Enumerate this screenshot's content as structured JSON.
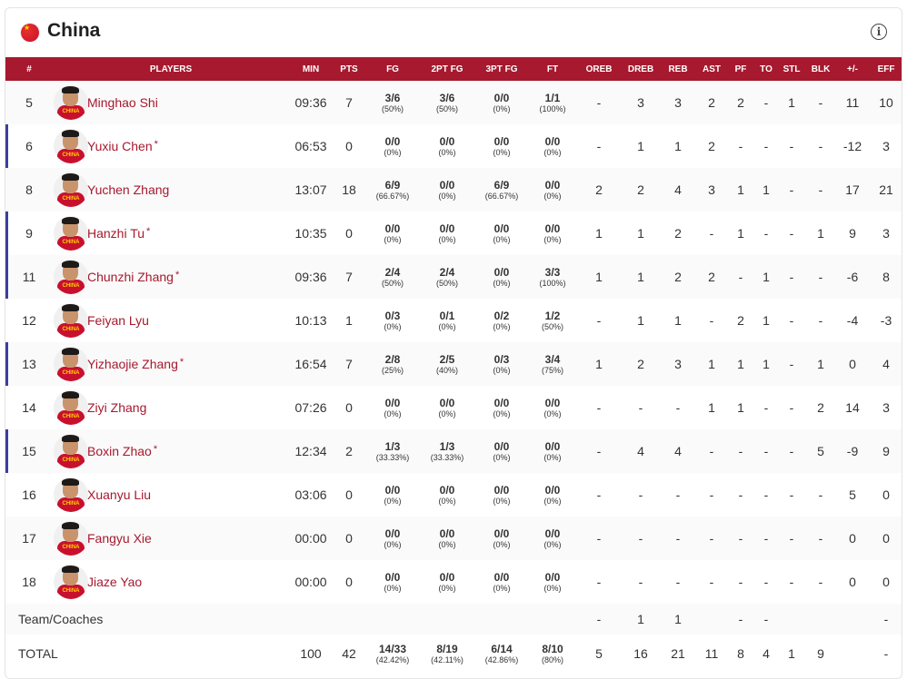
{
  "header": {
    "team_name": "China",
    "flag_icon": "china-flag-icon",
    "info_icon": "info-icon"
  },
  "colors": {
    "header_bar": "#a6192e",
    "player_name": "#a6192e",
    "starter_marker": "#3b3fa0"
  },
  "columns": [
    "#",
    "PLAYERS",
    "MIN",
    "PTS",
    "FG",
    "2PT FG",
    "3PT FG",
    "FT",
    "OREB",
    "DREB",
    "REB",
    "AST",
    "PF",
    "TO",
    "STL",
    "BLK",
    "+/-",
    "EFF"
  ],
  "players": [
    {
      "num": "5",
      "name": "Minghao Shi",
      "starter": false,
      "min": "09:36",
      "pts": "7",
      "fg": "3/6",
      "fg_pct": "(50%)",
      "p2": "3/6",
      "p2_pct": "(50%)",
      "p3": "0/0",
      "p3_pct": "(0%)",
      "ft": "1/1",
      "ft_pct": "(100%)",
      "oreb": "-",
      "dreb": "3",
      "reb": "3",
      "ast": "2",
      "pf": "2",
      "to": "-",
      "stl": "1",
      "blk": "-",
      "pm": "11",
      "eff": "10"
    },
    {
      "num": "6",
      "name": "Yuxiu Chen",
      "starter": true,
      "min": "06:53",
      "pts": "0",
      "fg": "0/0",
      "fg_pct": "(0%)",
      "p2": "0/0",
      "p2_pct": "(0%)",
      "p3": "0/0",
      "p3_pct": "(0%)",
      "ft": "0/0",
      "ft_pct": "(0%)",
      "oreb": "-",
      "dreb": "1",
      "reb": "1",
      "ast": "2",
      "pf": "-",
      "to": "-",
      "stl": "-",
      "blk": "-",
      "pm": "-12",
      "eff": "3"
    },
    {
      "num": "8",
      "name": "Yuchen Zhang",
      "starter": false,
      "min": "13:07",
      "pts": "18",
      "fg": "6/9",
      "fg_pct": "(66.67%)",
      "p2": "0/0",
      "p2_pct": "(0%)",
      "p3": "6/9",
      "p3_pct": "(66.67%)",
      "ft": "0/0",
      "ft_pct": "(0%)",
      "oreb": "2",
      "dreb": "2",
      "reb": "4",
      "ast": "3",
      "pf": "1",
      "to": "1",
      "stl": "-",
      "blk": "-",
      "pm": "17",
      "eff": "21"
    },
    {
      "num": "9",
      "name": "Hanzhi Tu",
      "starter": true,
      "min": "10:35",
      "pts": "0",
      "fg": "0/0",
      "fg_pct": "(0%)",
      "p2": "0/0",
      "p2_pct": "(0%)",
      "p3": "0/0",
      "p3_pct": "(0%)",
      "ft": "0/0",
      "ft_pct": "(0%)",
      "oreb": "1",
      "dreb": "1",
      "reb": "2",
      "ast": "-",
      "pf": "1",
      "to": "-",
      "stl": "-",
      "blk": "1",
      "pm": "9",
      "eff": "3"
    },
    {
      "num": "11",
      "name": "Chunzhi Zhang",
      "starter": true,
      "min": "09:36",
      "pts": "7",
      "fg": "2/4",
      "fg_pct": "(50%)",
      "p2": "2/4",
      "p2_pct": "(50%)",
      "p3": "0/0",
      "p3_pct": "(0%)",
      "ft": "3/3",
      "ft_pct": "(100%)",
      "oreb": "1",
      "dreb": "1",
      "reb": "2",
      "ast": "2",
      "pf": "-",
      "to": "1",
      "stl": "-",
      "blk": "-",
      "pm": "-6",
      "eff": "8"
    },
    {
      "num": "12",
      "name": "Feiyan Lyu",
      "starter": false,
      "min": "10:13",
      "pts": "1",
      "fg": "0/3",
      "fg_pct": "(0%)",
      "p2": "0/1",
      "p2_pct": "(0%)",
      "p3": "0/2",
      "p3_pct": "(0%)",
      "ft": "1/2",
      "ft_pct": "(50%)",
      "oreb": "-",
      "dreb": "1",
      "reb": "1",
      "ast": "-",
      "pf": "2",
      "to": "1",
      "stl": "-",
      "blk": "-",
      "pm": "-4",
      "eff": "-3"
    },
    {
      "num": "13",
      "name": "Yizhaojie Zhang",
      "starter": true,
      "min": "16:54",
      "pts": "7",
      "fg": "2/8",
      "fg_pct": "(25%)",
      "p2": "2/5",
      "p2_pct": "(40%)",
      "p3": "0/3",
      "p3_pct": "(0%)",
      "ft": "3/4",
      "ft_pct": "(75%)",
      "oreb": "1",
      "dreb": "2",
      "reb": "3",
      "ast": "1",
      "pf": "1",
      "to": "1",
      "stl": "-",
      "blk": "1",
      "pm": "0",
      "eff": "4"
    },
    {
      "num": "14",
      "name": "Ziyi Zhang",
      "starter": false,
      "min": "07:26",
      "pts": "0",
      "fg": "0/0",
      "fg_pct": "(0%)",
      "p2": "0/0",
      "p2_pct": "(0%)",
      "p3": "0/0",
      "p3_pct": "(0%)",
      "ft": "0/0",
      "ft_pct": "(0%)",
      "oreb": "-",
      "dreb": "-",
      "reb": "-",
      "ast": "1",
      "pf": "1",
      "to": "-",
      "stl": "-",
      "blk": "2",
      "pm": "14",
      "eff": "3"
    },
    {
      "num": "15",
      "name": "Boxin Zhao",
      "starter": true,
      "min": "12:34",
      "pts": "2",
      "fg": "1/3",
      "fg_pct": "(33.33%)",
      "p2": "1/3",
      "p2_pct": "(33.33%)",
      "p3": "0/0",
      "p3_pct": "(0%)",
      "ft": "0/0",
      "ft_pct": "(0%)",
      "oreb": "-",
      "dreb": "4",
      "reb": "4",
      "ast": "-",
      "pf": "-",
      "to": "-",
      "stl": "-",
      "blk": "5",
      "pm": "-9",
      "eff": "9"
    },
    {
      "num": "16",
      "name": "Xuanyu Liu",
      "starter": false,
      "min": "03:06",
      "pts": "0",
      "fg": "0/0",
      "fg_pct": "(0%)",
      "p2": "0/0",
      "p2_pct": "(0%)",
      "p3": "0/0",
      "p3_pct": "(0%)",
      "ft": "0/0",
      "ft_pct": "(0%)",
      "oreb": "-",
      "dreb": "-",
      "reb": "-",
      "ast": "-",
      "pf": "-",
      "to": "-",
      "stl": "-",
      "blk": "-",
      "pm": "5",
      "eff": "0"
    },
    {
      "num": "17",
      "name": "Fangyu Xie",
      "starter": false,
      "min": "00:00",
      "pts": "0",
      "fg": "0/0",
      "fg_pct": "(0%)",
      "p2": "0/0",
      "p2_pct": "(0%)",
      "p3": "0/0",
      "p3_pct": "(0%)",
      "ft": "0/0",
      "ft_pct": "(0%)",
      "oreb": "-",
      "dreb": "-",
      "reb": "-",
      "ast": "-",
      "pf": "-",
      "to": "-",
      "stl": "-",
      "blk": "-",
      "pm": "0",
      "eff": "0"
    },
    {
      "num": "18",
      "name": "Jiaze Yao",
      "starter": false,
      "min": "00:00",
      "pts": "0",
      "fg": "0/0",
      "fg_pct": "(0%)",
      "p2": "0/0",
      "p2_pct": "(0%)",
      "p3": "0/0",
      "p3_pct": "(0%)",
      "ft": "0/0",
      "ft_pct": "(0%)",
      "oreb": "-",
      "dreb": "-",
      "reb": "-",
      "ast": "-",
      "pf": "-",
      "to": "-",
      "stl": "-",
      "blk": "-",
      "pm": "0",
      "eff": "0"
    }
  ],
  "jersey_text": "CHINA",
  "starter_mark": "*",
  "team_row": {
    "label": "Team/Coaches",
    "oreb": "-",
    "dreb": "1",
    "reb": "1",
    "ast": "",
    "pf": "-",
    "to": "-",
    "stl": "",
    "blk": "",
    "pm": "",
    "eff": "-"
  },
  "total_row": {
    "label": "TOTAL",
    "min": "100",
    "pts": "42",
    "fg": "14/33",
    "fg_pct": "(42.42%)",
    "p2": "8/19",
    "p2_pct": "(42.11%)",
    "p3": "6/14",
    "p3_pct": "(42.86%)",
    "ft": "8/10",
    "ft_pct": "(80%)",
    "oreb": "5",
    "dreb": "16",
    "reb": "21",
    "ast": "11",
    "pf": "8",
    "to": "4",
    "stl": "1",
    "blk": "9",
    "pm": "",
    "eff": "-"
  }
}
